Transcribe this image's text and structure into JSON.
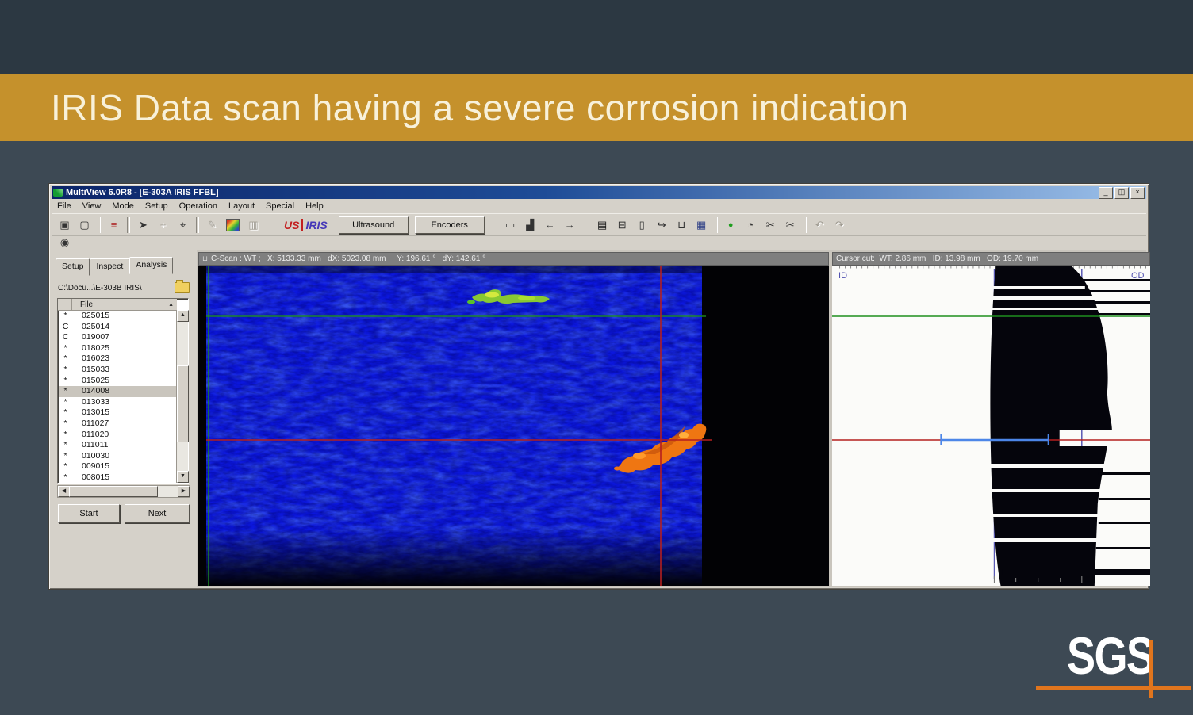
{
  "slide": {
    "title": "IRIS Data scan having a severe corrosion indication",
    "band_color": "#c5912c",
    "background_color": "#3d4954"
  },
  "window": {
    "title": "MultiView 6.0R8 - [E-303A IRIS FFBL]",
    "window_buttons": {
      "minimize": "_",
      "restore": "◫",
      "close": "×"
    },
    "menu": [
      "File",
      "View",
      "Mode",
      "Setup",
      "Operation",
      "Layout",
      "Special",
      "Help"
    ],
    "toolbar": {
      "us_label": "US",
      "iris_label": "IRIS",
      "ultrasound": "Ultrasound",
      "encoders": "Encoders",
      "items": [
        {
          "kind": "icon",
          "name": "single-view-icon",
          "glyph": "▣"
        },
        {
          "kind": "icon",
          "name": "tile-view-icon",
          "glyph": "▢"
        },
        {
          "kind": "sep"
        },
        {
          "kind": "icon",
          "name": "display-list-icon",
          "glyph": "≡"
        },
        {
          "kind": "sep"
        },
        {
          "kind": "icon",
          "name": "probe-pointer-icon",
          "glyph": "➤"
        },
        {
          "kind": "icon",
          "name": "pan-cursor-icon",
          "glyph": "+",
          "disabled": true
        },
        {
          "kind": "icon",
          "name": "zoom-cursor-icon",
          "glyph": "⌖"
        },
        {
          "kind": "sep"
        },
        {
          "kind": "icon",
          "name": "draw-icon",
          "glyph": "✎",
          "disabled": true
        },
        {
          "kind": "icon",
          "name": "palette-icon",
          "glyph": ""
        },
        {
          "kind": "icon",
          "name": "columns-icon",
          "glyph": "▥",
          "disabled": true
        },
        {
          "kind": "gap"
        },
        {
          "kind": "logo",
          "name": "us-iris-logo"
        },
        {
          "kind": "button",
          "name": "ultrasound-button",
          "label_key": "ultrasound"
        },
        {
          "kind": "button",
          "name": "encoders-button",
          "label_key": "encoders"
        },
        {
          "kind": "gap"
        },
        {
          "kind": "icon",
          "name": "ruler-icon",
          "glyph": "▭"
        },
        {
          "kind": "icon",
          "name": "histogram-icon",
          "glyph": "▟"
        },
        {
          "kind": "icon",
          "name": "prev-arrow-icon",
          "glyph": "←"
        },
        {
          "kind": "icon",
          "name": "next-arrow-icon",
          "glyph": "→"
        },
        {
          "kind": "gap"
        },
        {
          "kind": "icon",
          "name": "save-icon",
          "glyph": "▤"
        },
        {
          "kind": "icon",
          "name": "print-icon",
          "glyph": "⊟"
        },
        {
          "kind": "icon",
          "name": "report-icon",
          "glyph": "▯"
        },
        {
          "kind": "icon",
          "name": "export-icon",
          "glyph": "↪"
        },
        {
          "kind": "icon",
          "name": "delete-icon",
          "glyph": "⊔"
        },
        {
          "kind": "icon",
          "name": "table-icon",
          "glyph": "▦"
        },
        {
          "kind": "sep"
        },
        {
          "kind": "icon",
          "name": "scan-icon",
          "glyph": "●"
        },
        {
          "kind": "icon",
          "name": "gauge-icon",
          "glyph": "◔"
        },
        {
          "kind": "icon",
          "name": "measure-a-icon",
          "glyph": "✂"
        },
        {
          "kind": "icon",
          "name": "measure-b-icon",
          "glyph": "✂"
        },
        {
          "kind": "sep"
        },
        {
          "kind": "icon",
          "name": "undo-icon",
          "glyph": "↶",
          "disabled": true
        },
        {
          "kind": "icon",
          "name": "redo-icon",
          "glyph": "↷",
          "disabled": true
        }
      ],
      "snapshot_icon": "◉"
    }
  },
  "sidebar": {
    "tabs": [
      {
        "label": "Setup",
        "active": false
      },
      {
        "label": "Inspect",
        "active": false
      },
      {
        "label": "Analysis",
        "active": true
      }
    ],
    "path": "C:\\Docu...\\E-303B IRIS\\",
    "file_column_header": "File",
    "sort_arrow": "▲",
    "files": [
      {
        "status": "*",
        "name": "025015",
        "selected": false
      },
      {
        "status": "C",
        "name": "025014",
        "selected": false
      },
      {
        "status": "C",
        "name": "019007",
        "selected": false
      },
      {
        "status": "*",
        "name": "018025",
        "selected": false
      },
      {
        "status": "*",
        "name": "016023",
        "selected": false
      },
      {
        "status": "*",
        "name": "015033",
        "selected": false
      },
      {
        "status": "*",
        "name": "015025",
        "selected": false
      },
      {
        "status": "*",
        "name": "014008",
        "selected": true
      },
      {
        "status": "*",
        "name": "013033",
        "selected": false
      },
      {
        "status": "*",
        "name": "013015",
        "selected": false
      },
      {
        "status": "*",
        "name": "011027",
        "selected": false
      },
      {
        "status": "*",
        "name": "011020",
        "selected": false
      },
      {
        "status": "*",
        "name": "011011",
        "selected": false
      },
      {
        "status": "*",
        "name": "010030",
        "selected": false
      },
      {
        "status": "*",
        "name": "009015",
        "selected": false
      },
      {
        "status": "*",
        "name": "008015",
        "selected": false
      }
    ],
    "start_button": "Start",
    "next_button": "Next"
  },
  "cscan": {
    "header": "C-Scan : WT ;   X: 5133.33 mm   dX: 5023.08 mm     Y: 196.61 °   dY: 142.61 °"
  },
  "cursor_cut": {
    "header": "Cursor cut:  WT: 2.86 mm   ID: 13.98 mm   OD: 19.70 mm",
    "id_label": "ID",
    "od_label": "OD"
  },
  "footer": {
    "logo_text": "SGS",
    "logo_accent": "#e1751d"
  }
}
